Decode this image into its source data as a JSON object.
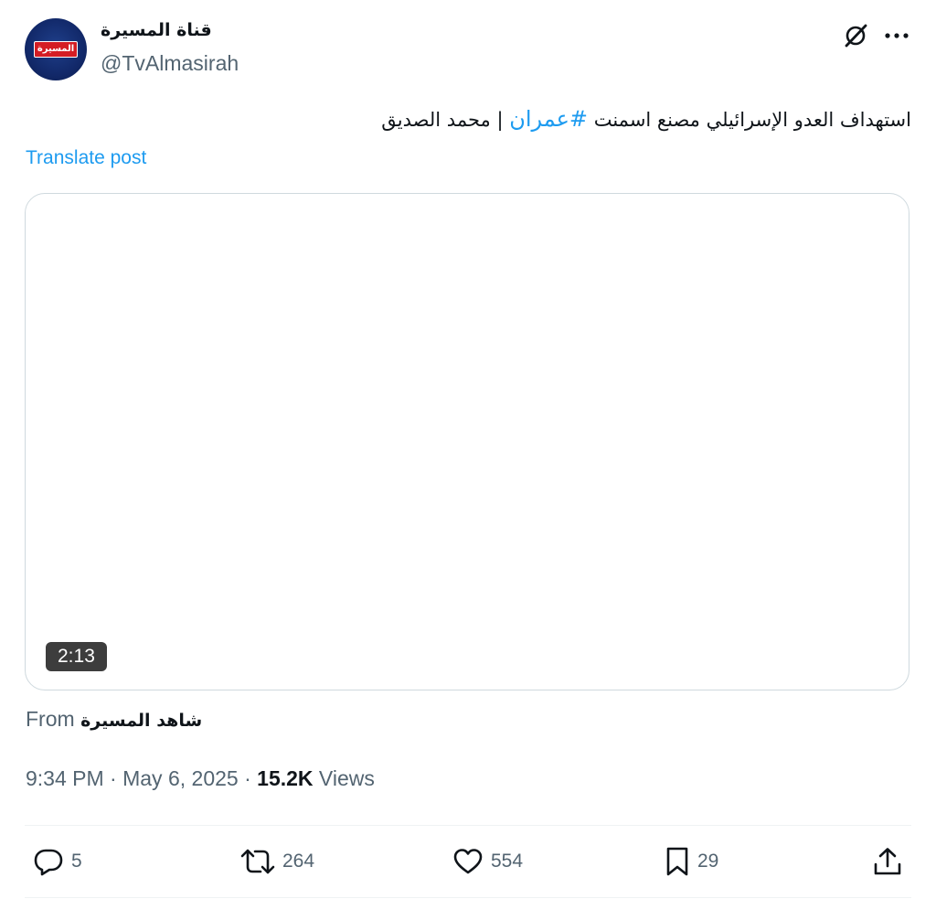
{
  "author": {
    "display_name": "قناة المسيرة",
    "handle": "@TvAlmasirah",
    "avatar_logo_text": "المسيرة"
  },
  "post": {
    "text_before": "استهداف العدو الإسرائيلي مصنع اسمنت ",
    "hashtag": "#عمران",
    "text_after": " | محمد الصديق",
    "translate_label": "Translate post"
  },
  "media": {
    "duration": "2:13"
  },
  "source": {
    "prefix": "From",
    "name": "شاهد المسيرة"
  },
  "meta": {
    "time": "9:34 PM",
    "separator": "·",
    "date": "May 6, 2025",
    "views_count": "15.2K",
    "views_label": "Views"
  },
  "actions": {
    "replies": "5",
    "reposts": "264",
    "likes": "554",
    "bookmarks": "29"
  },
  "icons": {
    "grok": "grok-icon",
    "more": "more-icon",
    "reply": "reply-icon",
    "repost": "repost-icon",
    "like": "heart-icon",
    "bookmark": "bookmark-icon",
    "share": "share-icon"
  },
  "colors": {
    "link": "#1d9bf0",
    "secondary_text": "#536471",
    "primary_text": "#0f1419",
    "border": "#cfd9de"
  }
}
